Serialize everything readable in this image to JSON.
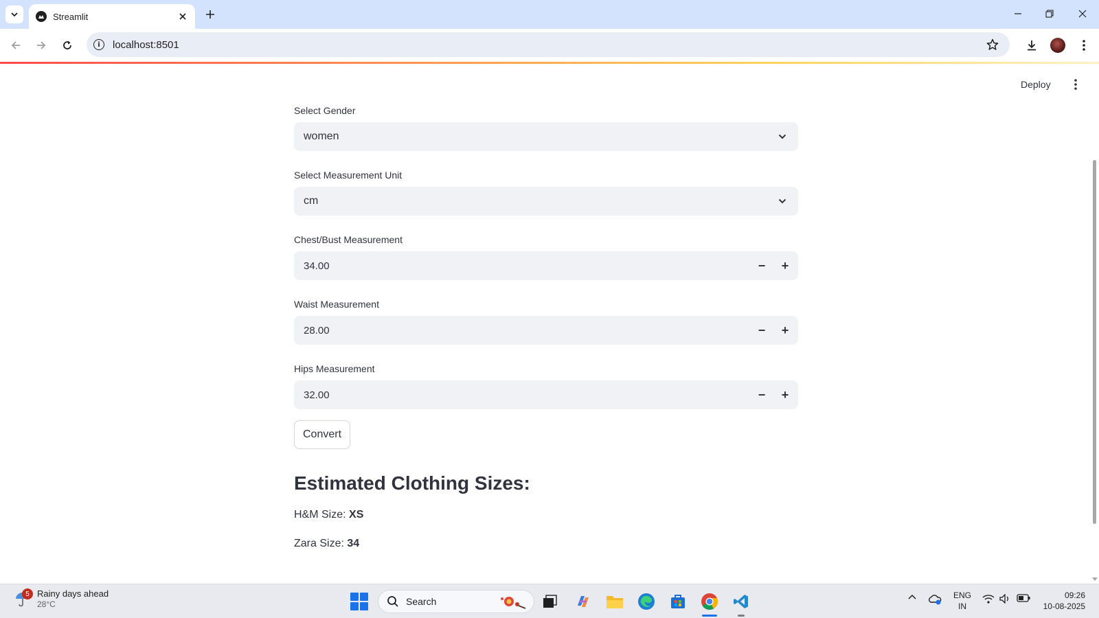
{
  "browser": {
    "tab_title": "Streamlit",
    "url": "localhost:8501"
  },
  "app": {
    "deploy_label": "Deploy",
    "gender": {
      "label": "Select Gender",
      "value": "women"
    },
    "unit": {
      "label": "Select Measurement Unit",
      "value": "cm"
    },
    "chest": {
      "label": "Chest/Bust Measurement",
      "value": "34.00"
    },
    "waist": {
      "label": "Waist Measurement",
      "value": "28.00"
    },
    "hips": {
      "label": "Hips Measurement",
      "value": "32.00"
    },
    "stepper": {
      "minus": "−",
      "plus": "+"
    },
    "convert_label": "Convert",
    "results": {
      "heading": "Estimated Clothing Sizes:",
      "hm_label": "H&M Size: ",
      "hm_value": "XS",
      "zara_label": "Zara Size: ",
      "zara_value": "34"
    }
  },
  "taskbar": {
    "weather_badge": "5",
    "weather_text": "Rainy days ahead",
    "weather_temp": "28°C",
    "search_placeholder": "Search",
    "lang_line1": "ENG",
    "lang_line2": "IN",
    "time": "09:26",
    "date": "10-08-2025"
  },
  "colors": {
    "accent": "#ff4b4b",
    "widget_bg": "#f0f2f6",
    "text": "#31333f",
    "tabbar": "#d3e3fd",
    "taskbar": "#e8eaf0"
  },
  "icons": [
    "tab-search-icon",
    "streamlit-favicon-icon",
    "close-icon",
    "plus-icon",
    "minimize-icon",
    "restore-icon",
    "window-close-icon",
    "back-icon",
    "forward-icon",
    "reload-icon",
    "info-icon",
    "star-icon",
    "download-icon",
    "profile-avatar",
    "kebab-menu-icon",
    "chevron-down-icon",
    "windows-start-icon",
    "search-icon"
  ]
}
